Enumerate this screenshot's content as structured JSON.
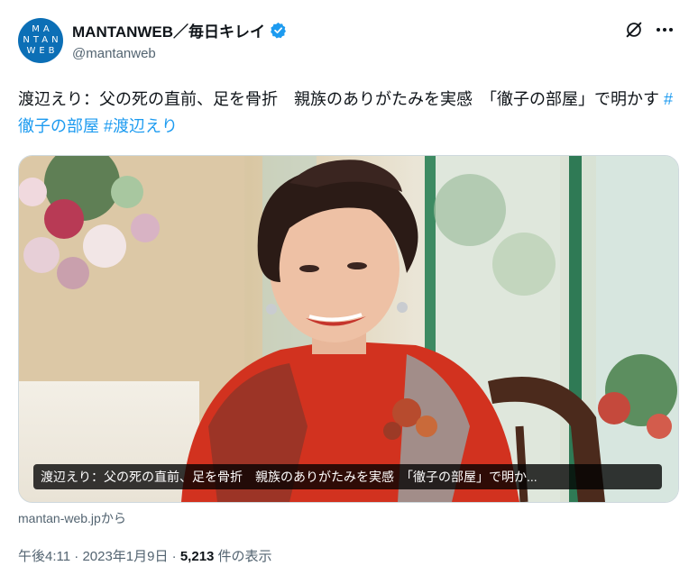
{
  "author": {
    "avatar_lines": [
      "MA",
      "NTAN",
      "WEB"
    ],
    "display_name": "MANTANWEB／毎日キレイ",
    "handle": "@mantanweb",
    "verified": true
  },
  "icons": {
    "verified": "verified-badge-icon",
    "grok": "grok-icon",
    "more": "more-icon"
  },
  "tweet": {
    "text": "渡辺えり：父の死の直前、足を骨折　親族のありがたみを実感　「徹子の部屋」で明かす ",
    "hashtags": [
      "#徹子の部屋",
      "#渡辺えり"
    ]
  },
  "media": {
    "caption": "渡辺えり：父の死の直前、足を骨折　親族のありがたみを実感　「徹子の部屋」で明か...",
    "source": "mantan-web.jpから"
  },
  "meta": {
    "time": "午後4:11",
    "sep1": " · ",
    "date": "2023年1月9日",
    "sep2": " · ",
    "views": "5,213",
    "views_suffix": " 件の表示"
  },
  "colors": {
    "link": "#1d9bf0",
    "verified": "#1d9bf0",
    "avatar_bg": "#0c6fb6",
    "text": "#0f1419",
    "muted": "#536471"
  }
}
